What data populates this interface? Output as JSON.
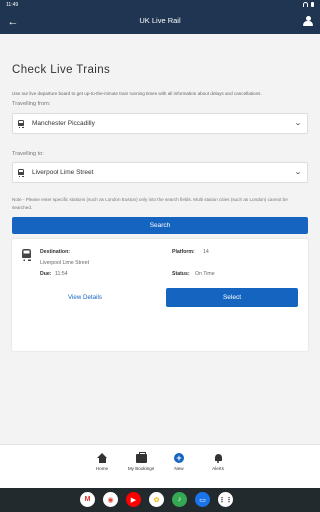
{
  "status_bar": {
    "time": "11:49"
  },
  "app_bar": {
    "title": "UK Live Rail"
  },
  "page": {
    "heading": "Check Live Trains",
    "intro": "Use our live departure board to get up-to-the-minute train running times with all information about delays and cancellations.",
    "from_label": "Travelling from:",
    "from_value": "Manchester Piccadilly",
    "to_label": "Travelling to:",
    "to_value": "Liverpool Lime Street",
    "note": "Note - Please enter specific stations (such as London Euston) only into the search fields. Multi station cities (such as London) cannot be searched.",
    "search_button": "Search"
  },
  "result_card": {
    "destination_label": "Destination:",
    "destination_value": "Liverpool Lime Street",
    "platform_label": "Platform:",
    "platform_value": "14",
    "due_label": "Due:",
    "due_value": "11:54",
    "status_label": "Status:",
    "status_value": "On Time",
    "view_details": "View Details",
    "select_button": "Select"
  },
  "bottom_nav": {
    "items": [
      {
        "label": "Home",
        "icon": "home-icon"
      },
      {
        "label": "My Bookings",
        "icon": "briefcase-icon"
      },
      {
        "label": "New",
        "icon": "add-circle-icon"
      },
      {
        "label": "Alerts",
        "icon": "bell-icon"
      }
    ]
  },
  "dock": {
    "apps": [
      {
        "glyph": "M",
        "icon": "gmail-icon",
        "color": "#ffffff",
        "fg": "#d93025"
      },
      {
        "glyph": "◉",
        "icon": "chrome-icon",
        "color": "#ffffff",
        "fg": "#db4437"
      },
      {
        "glyph": "▶",
        "icon": "youtube-icon",
        "color": "#ff0000",
        "fg": "#ffffff"
      },
      {
        "glyph": "✿",
        "icon": "photos-icon",
        "color": "#ffffff",
        "fg": "#f4b400"
      },
      {
        "glyph": "♪",
        "icon": "app-icon",
        "color": "#34a853",
        "fg": "#ffffff"
      },
      {
        "glyph": "▭",
        "icon": "messages-icon",
        "color": "#1a73e8",
        "fg": "#ffffff"
      },
      {
        "glyph": "⋮⋮",
        "icon": "app-drawer-icon",
        "color": "#ffffff",
        "fg": "#333333"
      }
    ]
  }
}
